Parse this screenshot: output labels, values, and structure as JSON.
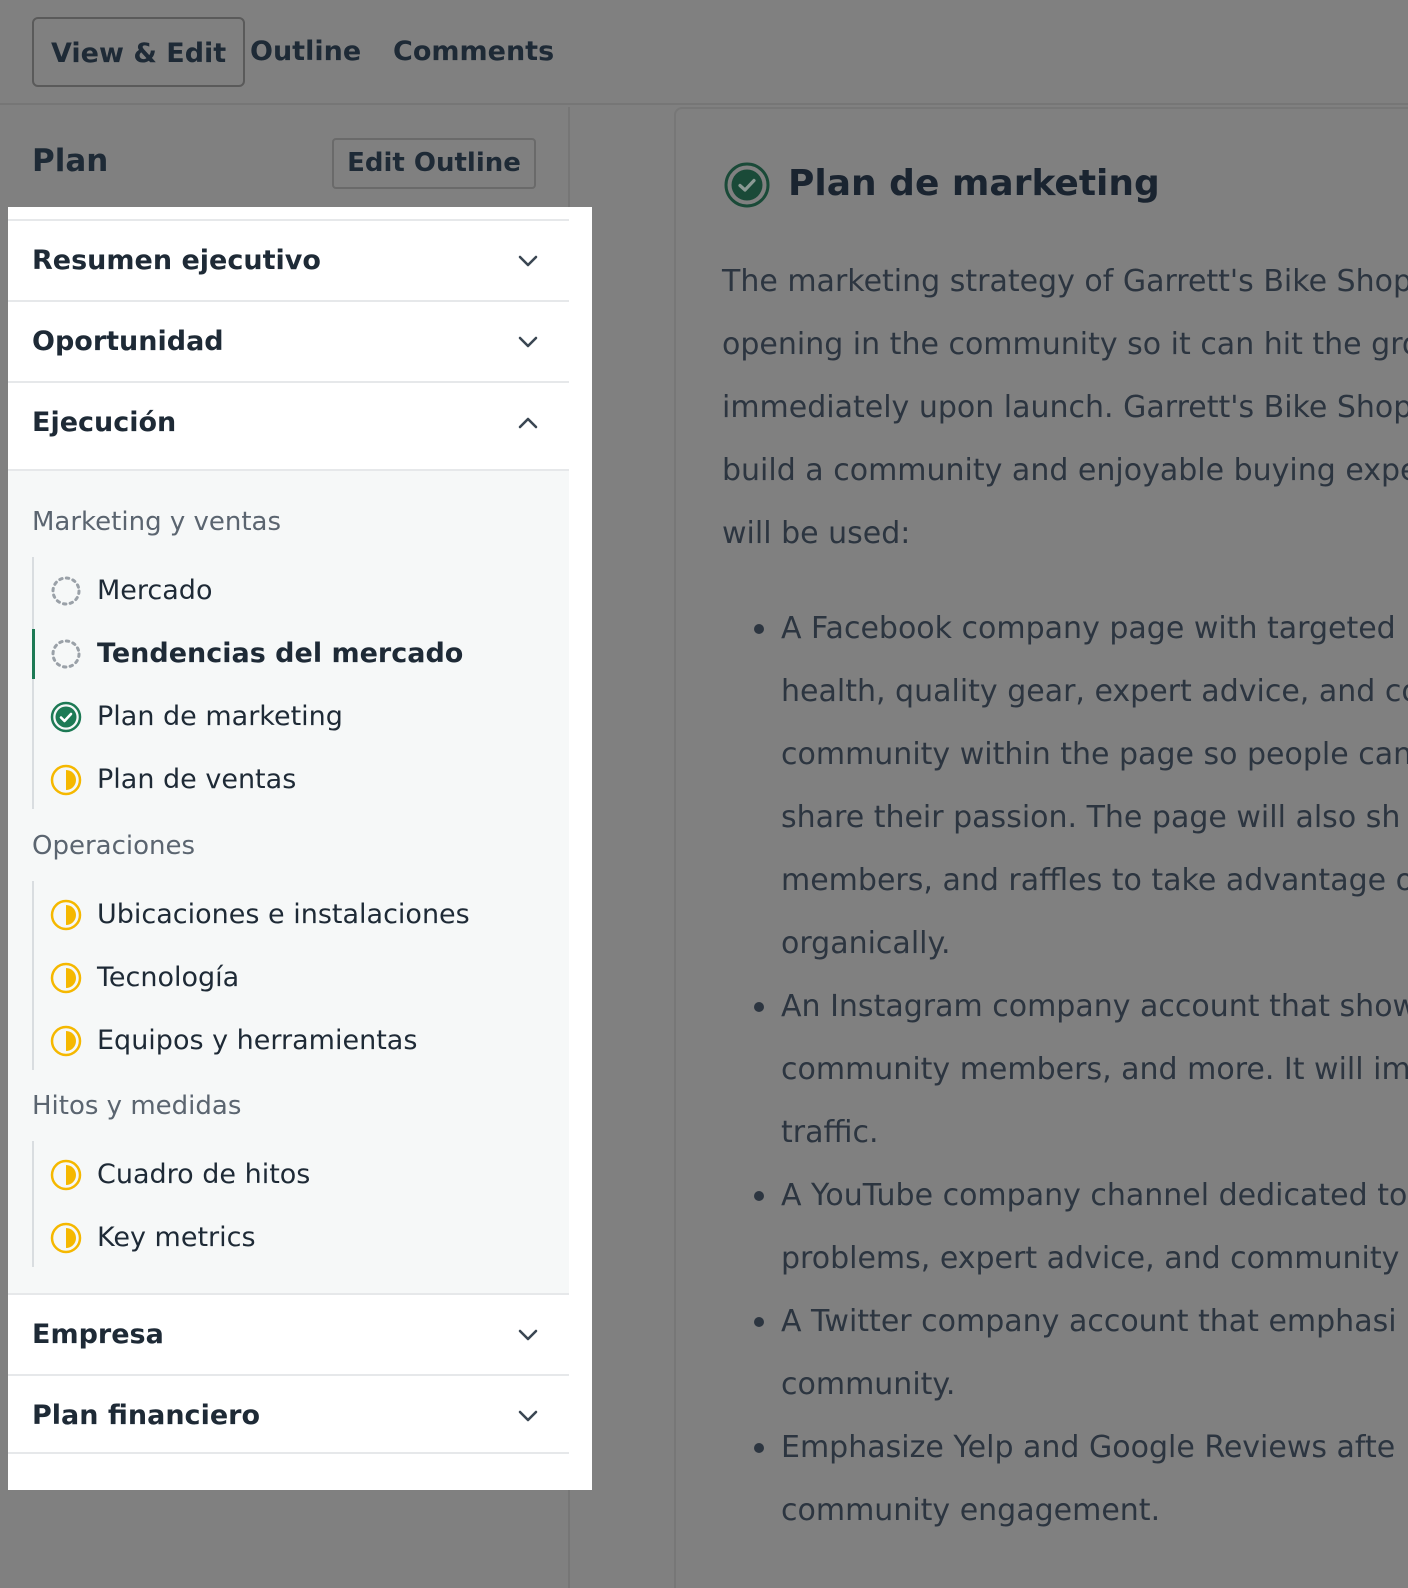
{
  "tabs": [
    {
      "label": "View & Edit",
      "active": true
    },
    {
      "label": "Outline",
      "active": false
    },
    {
      "label": "Comments",
      "active": false
    }
  ],
  "sidebar": {
    "title": "Plan",
    "edit_outline_label": "Edit Outline",
    "sections": [
      {
        "label": "Resumen ejecutivo",
        "expanded": false
      },
      {
        "label": "Oportunidad",
        "expanded": false
      },
      {
        "label": "Ejecución",
        "expanded": true
      },
      {
        "label": "Empresa",
        "expanded": false
      },
      {
        "label": "Plan financiero",
        "expanded": false
      }
    ],
    "groups": [
      {
        "label": "Marketing y ventas",
        "items": [
          {
            "label": "Mercado",
            "status": "empty"
          },
          {
            "label": "Tendencias del mercado",
            "status": "empty",
            "active": true
          },
          {
            "label": "Plan de marketing",
            "status": "complete"
          },
          {
            "label": "Plan de ventas",
            "status": "partial"
          }
        ]
      },
      {
        "label": "Operaciones",
        "items": [
          {
            "label": "Ubicaciones e instalaciones",
            "status": "partial"
          },
          {
            "label": "Tecnología",
            "status": "partial"
          },
          {
            "label": "Equipos y herramientas",
            "status": "partial"
          }
        ]
      },
      {
        "label": "Hitos y medidas",
        "items": [
          {
            "label": "Cuadro de hitos",
            "status": "partial"
          },
          {
            "label": "Key metrics",
            "status": "partial"
          }
        ]
      }
    ]
  },
  "document": {
    "title": "Plan de marketing",
    "status": "complete",
    "paragraph_lines": [
      "The marketing strategy of Garrett's Bike Shop",
      "opening in the community so it can hit the gro",
      "immediately upon launch. Garrett's Bike Shop",
      "build a community and enjoyable buying expe",
      "will be used:"
    ],
    "bullets": [
      {
        "lines": [
          "A Facebook company page with targeted",
          "health, quality gear, expert advice, and co",
          "community within the page so people can",
          "share their passion. The page will also sh",
          "members, and raffles to take advantage o",
          "organically."
        ]
      },
      {
        "lines": [
          "An Instagram company account that show",
          "community members, and more. It will imp",
          "traffic."
        ]
      },
      {
        "lines": [
          "A YouTube company channel dedicated to",
          "problems, expert advice, and community l"
        ]
      },
      {
        "lines": [
          "A Twitter company account that emphasi",
          "community."
        ]
      },
      {
        "lines": [
          "Emphasize Yelp and Google Reviews afte",
          "community engagement."
        ]
      }
    ]
  },
  "colors": {
    "overlay": "#808080",
    "panel": "#ffffff",
    "expanded_bg": "#f6f8f8",
    "complete_green": "#1d7a55",
    "partial_yellow": "#f5b800",
    "text_dark": "#1e2a36"
  }
}
